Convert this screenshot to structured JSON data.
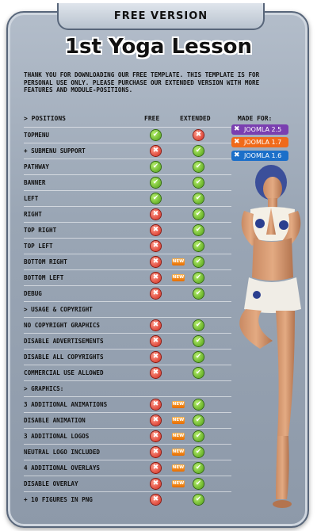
{
  "header": {
    "tab_label": "FREE VERSION",
    "title": "1st Yoga Lesson"
  },
  "intro": "Thank you for downloading our free template. This template is for personal use only. Please purchase our extended version with more features and module-positions.",
  "columns": {
    "feature": "> Positions",
    "free": "FREE",
    "extended": "EXTENDED",
    "made_for": "MADE FOR:"
  },
  "badges": [
    {
      "label": "JOOMLA 2.5",
      "color": "#7a3fb0"
    },
    {
      "label": "JOOMLA 1.7",
      "color": "#f06a1a"
    },
    {
      "label": "JOOMLA 1.6",
      "color": "#1b6fc9"
    }
  ],
  "status_colors": {
    "ok": "#5bb11a",
    "no": "#d9301f",
    "new": "#f08a00"
  },
  "new_label": "NEW",
  "rows": [
    {
      "label": "Topmenu",
      "free": "ok",
      "extended": "no",
      "new": false
    },
    {
      "label": "+ Submenu support",
      "free": "no",
      "extended": "ok",
      "new": false
    },
    {
      "label": "Pathway",
      "free": "ok",
      "extended": "ok",
      "new": false
    },
    {
      "label": "Banner",
      "free": "ok",
      "extended": "ok",
      "new": false
    },
    {
      "label": "Left",
      "free": "ok",
      "extended": "ok",
      "new": false
    },
    {
      "label": "Right",
      "free": "no",
      "extended": "ok",
      "new": false
    },
    {
      "label": "Top Right",
      "free": "no",
      "extended": "ok",
      "new": false
    },
    {
      "label": "Top Left",
      "free": "no",
      "extended": "ok",
      "new": false
    },
    {
      "label": "Bottom Right",
      "free": "no",
      "extended": "ok",
      "new": true
    },
    {
      "label": "Bottom Left",
      "free": "no",
      "extended": "ok",
      "new": true
    },
    {
      "label": "Debug",
      "free": "no",
      "extended": "ok",
      "new": false
    },
    {
      "label": "> Usage & Copyright",
      "section": true
    },
    {
      "label": "No Copyright Graphics",
      "free": "no",
      "extended": "ok",
      "new": false
    },
    {
      "label": "Disable Advertisements",
      "free": "no",
      "extended": "ok",
      "new": false
    },
    {
      "label": "Disable all Copyrights",
      "free": "no",
      "extended": "ok",
      "new": false
    },
    {
      "label": "Commercial use allowed",
      "free": "no",
      "extended": "ok",
      "new": false
    },
    {
      "label": "> Graphics:",
      "section": true
    },
    {
      "label": "3 Additional Animations",
      "free": "no",
      "extended": "ok",
      "new": true
    },
    {
      "label": "Disable Animation",
      "free": "no",
      "extended": "ok",
      "new": true
    },
    {
      "label": "3 Additional Logos",
      "free": "no",
      "extended": "ok",
      "new": true
    },
    {
      "label": "Neutral Logo included",
      "free": "no",
      "extended": "ok",
      "new": true
    },
    {
      "label": "4 Additional Overlays",
      "free": "no",
      "extended": "ok",
      "new": true
    },
    {
      "label": "Disable Overlay",
      "free": "no",
      "extended": "ok",
      "new": true
    },
    {
      "label": "+ 10 Figures in PNG",
      "free": "no",
      "extended": "ok",
      "new": false
    }
  ]
}
